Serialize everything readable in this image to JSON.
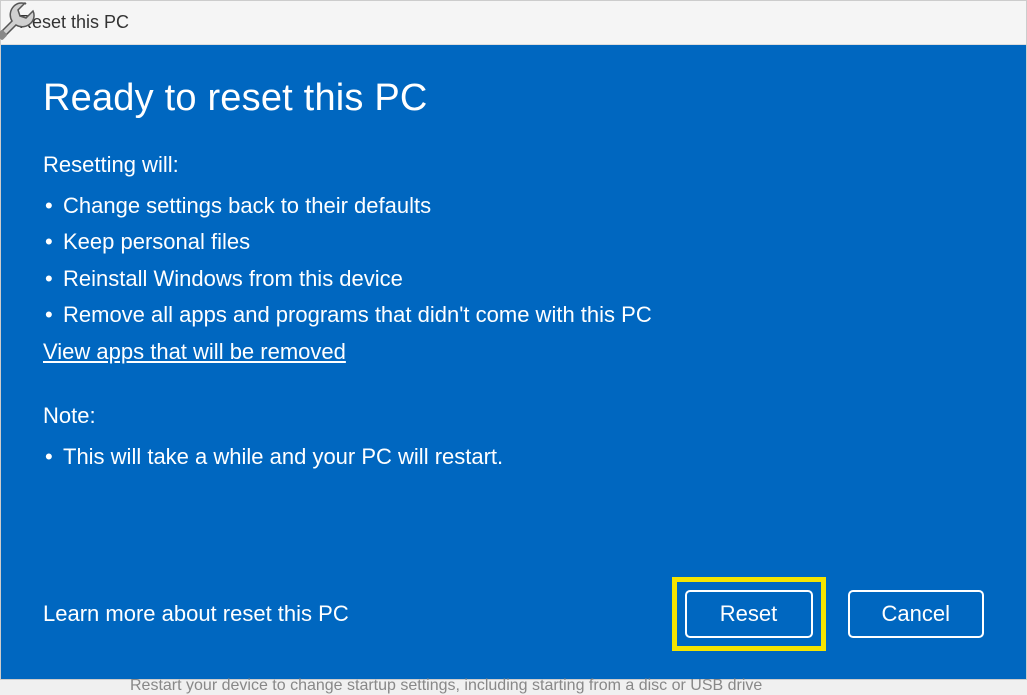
{
  "titlebar": {
    "title": "Reset this PC"
  },
  "main": {
    "heading": "Ready to reset this PC",
    "resetting_label": "Resetting will:",
    "resetting_items": [
      "Change settings back to their defaults",
      "Keep personal files",
      "Reinstall Windows from this device",
      "Remove all apps and programs that didn't come with this PC"
    ],
    "view_apps_link": "View apps that will be removed",
    "note_label": "Note:",
    "note_items": [
      "This will take a while and your PC will restart."
    ],
    "learn_more": "Learn more about reset this PC"
  },
  "buttons": {
    "reset": "Reset",
    "cancel": "Cancel"
  },
  "background": {
    "partial_text": "Restart your device to change startup settings, including starting from a disc or USB drive"
  },
  "colors": {
    "accent": "#0067c0",
    "highlight": "#f5e400"
  }
}
